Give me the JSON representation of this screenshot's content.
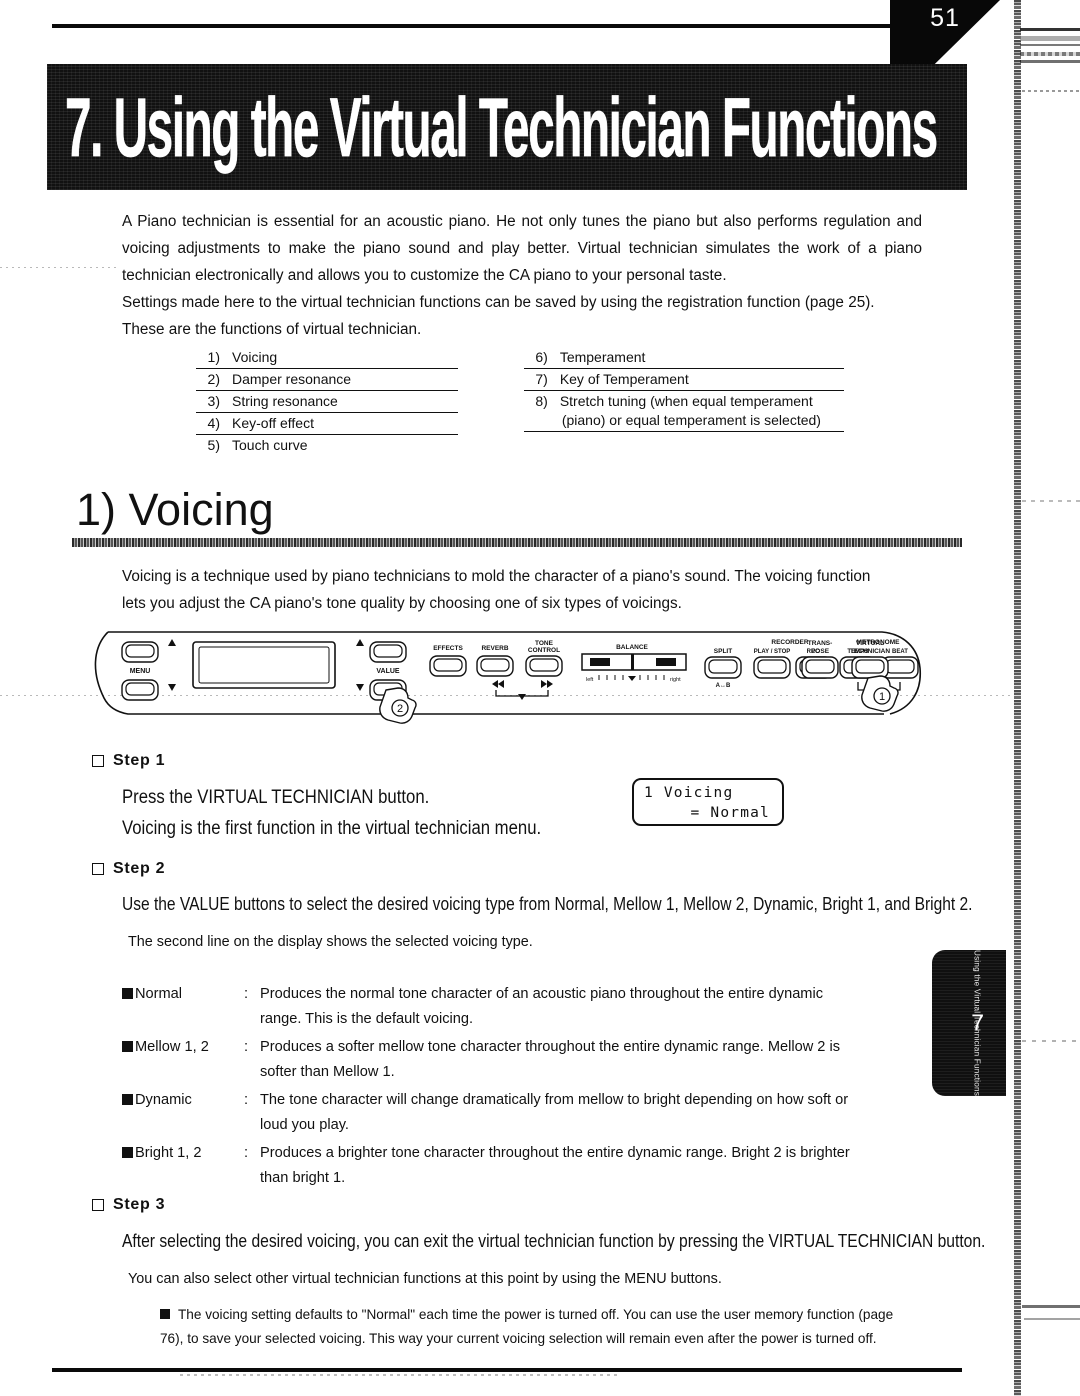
{
  "page": {
    "number": "51",
    "chapter_banner": "7. Using the Virtual Technician Functions",
    "side_tab_text": "Using the Virtual Technician Functions",
    "side_tab_number": "7"
  },
  "intro": {
    "p1": "A Piano technician is essential for an acoustic piano. He not only tunes the piano but also performs regulation and voicing adjustments to make the piano sound and play better. Virtual technician simulates the work of a piano technician electronically and allows you to customize the CA piano to your personal taste.",
    "p2": "Settings made here to the virtual technician functions can be saved by using the registration function (page 25).",
    "p3": "These are the functions of virtual technician."
  },
  "function_list": {
    "left": [
      {
        "num": "1)",
        "label": "Voicing"
      },
      {
        "num": "2)",
        "label": "Damper resonance"
      },
      {
        "num": "3)",
        "label": "String resonance"
      },
      {
        "num": "4)",
        "label": "Key-off effect"
      },
      {
        "num": "5)",
        "label": "Touch curve"
      }
    ],
    "right": [
      {
        "num": "6)",
        "label": "Temperament"
      },
      {
        "num": "7)",
        "label": "Key of Temperament"
      },
      {
        "num": "8)",
        "label": "Stretch tuning (when equal temperament",
        "label2": "(piano) or equal temperament is selected)"
      }
    ]
  },
  "section": {
    "heading": "1) Voicing",
    "body_p1": "Voicing is a technique used by piano technicians to mold the character of a piano's sound. The voicing function",
    "body_p2": "lets you adjust the CA piano's tone quality by choosing one of six types of voicings."
  },
  "panel": {
    "labels": {
      "menu": "MENU",
      "value": "VALUE",
      "effects": "EFFECTS",
      "reverb": "REVERB",
      "tone_control_1": "TONE",
      "tone_control_2": "CONTROL",
      "balance": "BALANCE",
      "balance_left": "left",
      "balance_right": "right",
      "split": "SPLIT",
      "split_sub": "A↔B",
      "recorder": "RECORDER",
      "play_stop": "PLAY / STOP",
      "rec": "REC",
      "metronome": "METRONOME",
      "tempo": "TEMPO",
      "beat": "BEAT",
      "volume": "VOLUME",
      "transpose_1": "TRANS-",
      "transpose_2": "POSE",
      "virtual_1": "VIRTUAL",
      "virtual_2": "TECHNICIAN"
    },
    "callouts": {
      "one": "①",
      "two": "②"
    }
  },
  "steps": [
    {
      "label": "Step 1",
      "line1": "Press the VIRTUAL TECHNICIAN button.",
      "line2": "Voicing is the first function in the virtual technician menu."
    },
    {
      "label": "Step 2",
      "line1": "Use the VALUE buttons to select the desired voicing type from Normal, Mellow 1, Mellow 2, Dynamic, Bright 1, and Bright 2.",
      "note": "The second line on the display shows the selected voicing type."
    },
    {
      "label": "Step 3",
      "line1": "After selecting the desired voicing, you can exit the virtual technician function by pressing the VIRTUAL TECHNICIAN button.",
      "note": "You can also select other virtual technician functions at this point by using the MENU buttons."
    }
  ],
  "lcd": {
    "line1": "1 Voicing",
    "line2": "= Normal"
  },
  "voicing_types": [
    {
      "term": "Normal",
      "colon": ":",
      "desc_line1": "Produces the normal tone character of an acoustic piano throughout the entire dynamic",
      "desc_line2": "range. This is the default voicing."
    },
    {
      "term": "Mellow 1, 2",
      "colon": ":",
      "desc_line1": "Produces a softer mellow tone character throughout the entire dynamic range. Mellow 2 is",
      "desc_line2": "softer than Mellow 1."
    },
    {
      "term": "Dynamic",
      "colon": ":",
      "desc_line1": "The tone character will change dramatically from mellow to bright depending on how soft or",
      "desc_line2": "loud you play."
    },
    {
      "term": "Bright 1, 2",
      "colon": ":",
      "desc_line1": "Produces a brighter tone character throughout the entire dynamic range. Bright 2 is brighter",
      "desc_line2": "than bright 1."
    }
  ],
  "footer_note": {
    "line1": "The voicing setting defaults to \"Normal\" each time the power is turned off. You can use the user memory function (page",
    "line2": "76), to save your selected voicing. This way your current voicing selection will remain even after the power is turned off."
  }
}
